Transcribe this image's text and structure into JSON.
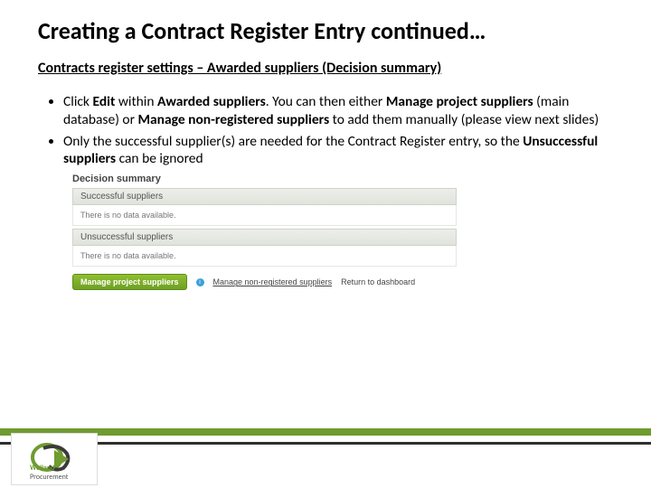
{
  "title": "Creating a Contract Register Entry continued…",
  "subtitle": "Contracts register settings – Awarded suppliers (Decision summary)",
  "bullets": {
    "b1": {
      "t1": "Click ",
      "bold1": "Edit",
      "t2": " within ",
      "bold2": "Awarded suppliers",
      "t3": ". You can then either ",
      "bold3": "Manage project suppliers",
      "t4": " (main database) or ",
      "bold4": "Manage non-registered suppliers",
      "t5": " to add them manually (please view next slides)"
    },
    "b2": {
      "t1": "Only the successful supplier(s) are needed for the Contract Register entry, so the ",
      "bold1": "Unsuccessful suppliers",
      "t2": " can be ignored"
    }
  },
  "panel": {
    "title": "Decision summary",
    "sec1_head": "Successful suppliers",
    "sec1_body": "There is no data available.",
    "sec2_head": "Unsuccessful suppliers",
    "sec2_body": "There is no data available.",
    "btn": "Manage project suppliers",
    "link1": "Manage non-registered suppliers",
    "link2": "Return to dashboard"
  },
  "logo": {
    "brand1": "Welland",
    "brand2": "Procurement"
  }
}
